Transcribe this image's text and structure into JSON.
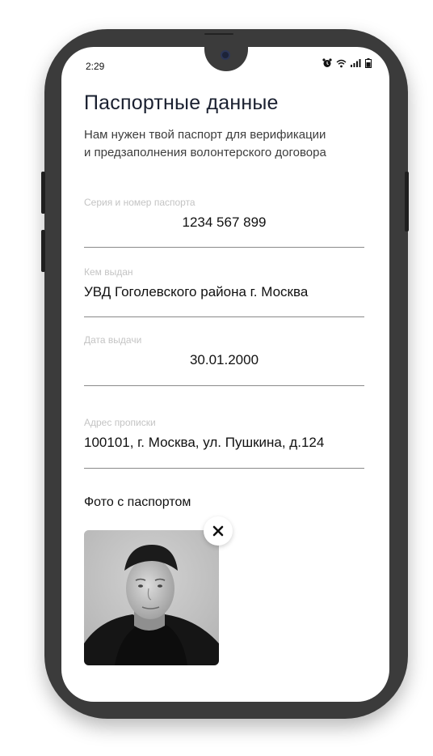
{
  "status_bar": {
    "time": "2:29",
    "icons": [
      "alarm-icon",
      "wifi-icon",
      "signal-icon",
      "battery-icon"
    ]
  },
  "page": {
    "title": "Паспортные данные",
    "subtitle": "Нам нужен твой паспорт для верификации и предзаполнения волонтерского договора"
  },
  "fields": {
    "passport_number": {
      "label": "Серия и номер паспорта",
      "value": "1234 567 899"
    },
    "issued_by": {
      "label": "Кем выдан",
      "value": "УВД Гоголевского района г. Москва"
    },
    "issue_date": {
      "label": "Дата выдачи",
      "value": "30.01.2000"
    },
    "address": {
      "label": "Адрес прописки",
      "value": "100101, г. Москва, ул. Пушкина, д.124"
    }
  },
  "photo_section": {
    "label": "Фото с паспортом",
    "remove_icon": "close-icon"
  },
  "colors": {
    "phone_frame": "#3b3b3b",
    "screen_bg": "#ffffff",
    "label": "#c4c4c4",
    "text": "#111111",
    "title": "#1a2030",
    "divider": "#8a8a8a"
  }
}
